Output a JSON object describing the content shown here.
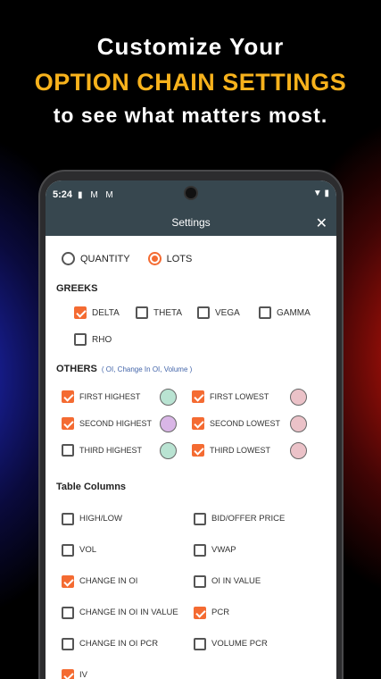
{
  "headline": {
    "line1": "Customize Your",
    "line2": "OPTION CHAIN SETTINGS",
    "line3": "to see what matters most."
  },
  "statusbar": {
    "time": "5:24",
    "icons": "▮ M M",
    "right_icons": "▼ ▮"
  },
  "appbar": {
    "title": "Settings",
    "close": "✕"
  },
  "mode": {
    "options": [
      {
        "label": "QUANTITY",
        "selected": false
      },
      {
        "label": "LOTS",
        "selected": true
      }
    ]
  },
  "greeks": {
    "title": "GREEKS",
    "items": [
      {
        "label": "DELTA",
        "checked": true
      },
      {
        "label": "THETA",
        "checked": false
      },
      {
        "label": "VEGA",
        "checked": false
      },
      {
        "label": "GAMMA",
        "checked": false
      },
      {
        "label": "RHO",
        "checked": false
      }
    ]
  },
  "others": {
    "title": "OTHERS",
    "subtitle": "( OI, Change In OI, Volume )",
    "rows": [
      [
        {
          "label": "FIRST HIGHEST",
          "checked": true,
          "color": "#b9e3d2"
        },
        {
          "label": "FIRST LOWEST",
          "checked": true,
          "color": "#ebc2c8"
        }
      ],
      [
        {
          "label": "SECOND HIGHEST",
          "checked": true,
          "color": "#d9b6e6"
        },
        {
          "label": "SECOND LOWEST",
          "checked": true,
          "color": "#ebc2c8"
        }
      ],
      [
        {
          "label": "THIRD HIGHEST",
          "checked": false,
          "color": "#b9e3d2"
        },
        {
          "label": "THIRD LOWEST",
          "checked": true,
          "color": "#ebc2c8"
        }
      ]
    ]
  },
  "table_columns": {
    "title": "Table Columns",
    "rows": [
      [
        {
          "label": "HIGH/LOW",
          "checked": false
        },
        {
          "label": "BID/OFFER PRICE",
          "checked": false
        }
      ],
      [
        {
          "label": "VOL",
          "checked": false
        },
        {
          "label": "VWAP",
          "checked": false
        }
      ],
      [
        {
          "label": "CHANGE IN OI",
          "checked": true
        },
        {
          "label": "OI IN VALUE",
          "checked": false
        }
      ],
      [
        {
          "label": "CHANGE IN OI IN VALUE",
          "checked": false
        },
        {
          "label": "PCR",
          "checked": true
        }
      ],
      [
        {
          "label": "CHANGE IN OI PCR",
          "checked": false
        },
        {
          "label": "VOLUME PCR",
          "checked": false
        }
      ],
      [
        {
          "label": "IV",
          "checked": true
        }
      ]
    ]
  },
  "colors": {
    "accent": "#f46b32",
    "appbar": "#37474f",
    "headline_accent": "#f7b21c"
  }
}
